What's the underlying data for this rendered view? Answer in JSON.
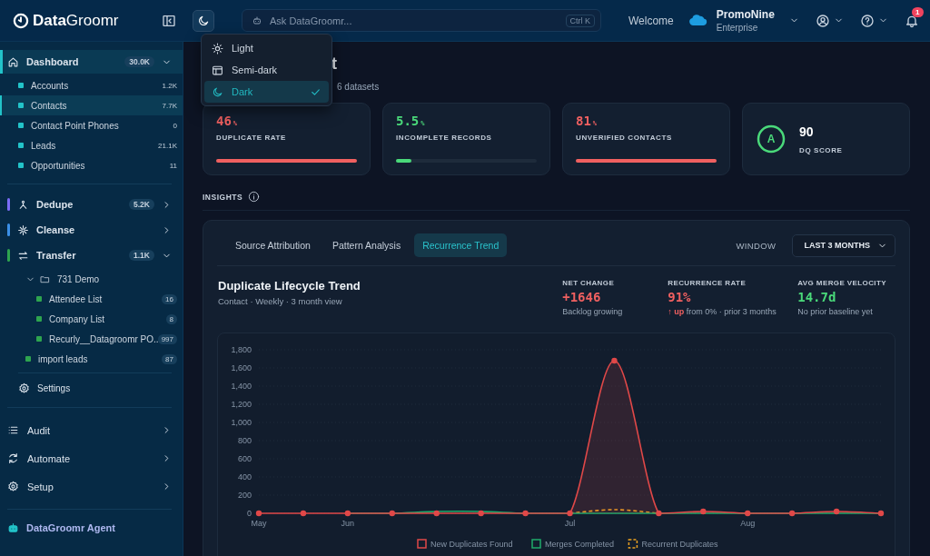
{
  "topbar": {
    "logo": {
      "bold": "Data",
      "light": "Groomr"
    },
    "search": {
      "placeholder": "Ask DataGroomr...",
      "shortcut": "Ctrl K"
    },
    "welcome": "Welcome",
    "org": {
      "name": "PromoNine",
      "edition": "Enterprise"
    },
    "notifications": "1"
  },
  "theme_menu": [
    {
      "kind": "light",
      "label": "Light",
      "selected": false
    },
    {
      "kind": "semi-dark",
      "label": "Semi-dark",
      "selected": false
    },
    {
      "kind": "dark",
      "label": "Dark",
      "selected": true
    }
  ],
  "sidebar": {
    "nav": [
      {
        "kind": "module",
        "label": "Dashboard",
        "count": "30.0K",
        "expanded": true,
        "selected": true,
        "color": "#22c3c9",
        "children": [
          {
            "kind": "dataset",
            "label": "Accounts",
            "count": "1.2K",
            "selected": false
          },
          {
            "kind": "dataset",
            "label": "Contacts",
            "count": "7.7K",
            "selected": true
          },
          {
            "kind": "dataset",
            "label": "Contact Point Phones",
            "count": "0",
            "selected": false
          },
          {
            "kind": "dataset",
            "label": "Leads",
            "count": "21.1K",
            "selected": false
          },
          {
            "kind": "dataset",
            "label": "Opportunities",
            "count": "11",
            "selected": false
          }
        ]
      },
      {
        "kind": "module",
        "label": "Dedupe",
        "count": "5.2K",
        "expanded": false,
        "selected": false,
        "color": "#7b6cf6"
      },
      {
        "kind": "module",
        "label": "Cleanse",
        "expanded": false,
        "selected": false,
        "color": "#3b8fe6"
      },
      {
        "kind": "module",
        "label": "Transfer",
        "count": "1.1K",
        "expanded": true,
        "selected": false,
        "color": "#2ea44f",
        "children": [
          {
            "kind": "folder",
            "label": "731 Demo",
            "expanded": true,
            "children": [
              {
                "kind": "dataset",
                "label": "Attendee List",
                "count": "16",
                "selected": false
              },
              {
                "kind": "dataset",
                "label": "Company List",
                "count": "8",
                "selected": false
              },
              {
                "kind": "dataset",
                "label": "Recurly__Datagroomr PO...",
                "count": "997",
                "selected": false
              }
            ]
          },
          {
            "kind": "dataset",
            "label": "import leads",
            "count": "87",
            "selected": false
          },
          {
            "kind": "settings",
            "label": "Settings"
          }
        ]
      },
      {
        "kind": "link",
        "label": "Audit"
      },
      {
        "kind": "link",
        "label": "Automate"
      },
      {
        "kind": "link",
        "label": "Setup"
      }
    ],
    "agent": "DataGroomr Agent"
  },
  "page_header": {
    "title": "t",
    "subtitle": "6 datasets"
  },
  "metrics": [
    {
      "value": "46",
      "unit": "%",
      "label": "DUPLICATE RATE",
      "level": 1.0,
      "color": "#f06060"
    },
    {
      "value": "5.5",
      "unit": "%",
      "label": "INCOMPLETE RECORDS",
      "level": 0.11,
      "color": "#4ad97a"
    },
    {
      "value": "81",
      "unit": "%",
      "label": "UNVERIFIED CONTACTS",
      "level": 1.0,
      "color": "#f06060"
    }
  ],
  "dq_score": {
    "grade": "A",
    "value": "90",
    "label": "DQ SCORE",
    "level": 1.0
  },
  "insights": {
    "title": "INSIGHTS",
    "tabs": [
      {
        "label": "Source Attribution",
        "selected": false
      },
      {
        "label": "Pattern Analysis",
        "selected": false
      },
      {
        "label": "Recurrence Trend",
        "selected": true
      }
    ],
    "window": {
      "label": "WINDOW",
      "value": "LAST 3 MONTHS"
    },
    "trend": {
      "title": "Duplicate Lifecycle Trend",
      "meta": "Contact · Weekly · 3 month view",
      "stats": [
        {
          "label": "NET CHANGE",
          "value": "+1646",
          "color": "#f06060",
          "note": "Backlog growing"
        },
        {
          "label": "RECURRENCE RATE",
          "value": "91%",
          "color": "#f06060",
          "note": "**↑ up** from 0% · prior 3 months"
        },
        {
          "label": "AVG MERGE VELOCITY",
          "value": "14.7d",
          "color": "#4ad97a",
          "note": "No prior baseline yet"
        }
      ],
      "chart_data": {
        "type": "line",
        "categories": [
          "May",
          null,
          "Jun",
          null,
          null,
          null,
          null,
          "Jul",
          null,
          null,
          null,
          "Aug",
          null,
          null,
          null
        ],
        "ylim": [
          0,
          1800
        ],
        "grid": true,
        "legend": "bottom",
        "yticks": [
          {
            "value": 0,
            "label": "0"
          },
          {
            "value": 200,
            "label": "200"
          },
          {
            "value": 400,
            "label": "400"
          },
          {
            "value": 600,
            "label": "600"
          },
          {
            "value": 800,
            "label": "800"
          },
          {
            "value": 1000,
            "label": "1,000"
          },
          {
            "value": 1200,
            "label": "1,200"
          },
          {
            "value": 1400,
            "label": "1,400"
          },
          {
            "value": 1600,
            "label": "1,600"
          },
          {
            "value": 1800,
            "label": "1,800"
          }
        ],
        "series": [
          {
            "name": "New Duplicates Found",
            "color": "#e04848",
            "marker": "circle",
            "values": [
              0,
              0,
              0,
              0,
              0,
              0,
              0,
              0,
              1680,
              0,
              20,
              0,
              0,
              20,
              0
            ]
          },
          {
            "name": "Merges Completed",
            "color": "#1faa6b",
            "values": [
              null,
              null,
              0,
              0,
              20,
              20,
              0,
              0,
              0,
              0,
              0,
              0,
              0,
              0,
              0
            ]
          },
          {
            "name": "Recurrent Duplicates",
            "color": "#e8a020",
            "line_style": "dashed",
            "values": [
              null,
              null,
              null,
              null,
              null,
              null,
              null,
              0,
              40,
              0,
              null,
              null,
              null,
              null,
              null
            ]
          }
        ]
      }
    }
  }
}
